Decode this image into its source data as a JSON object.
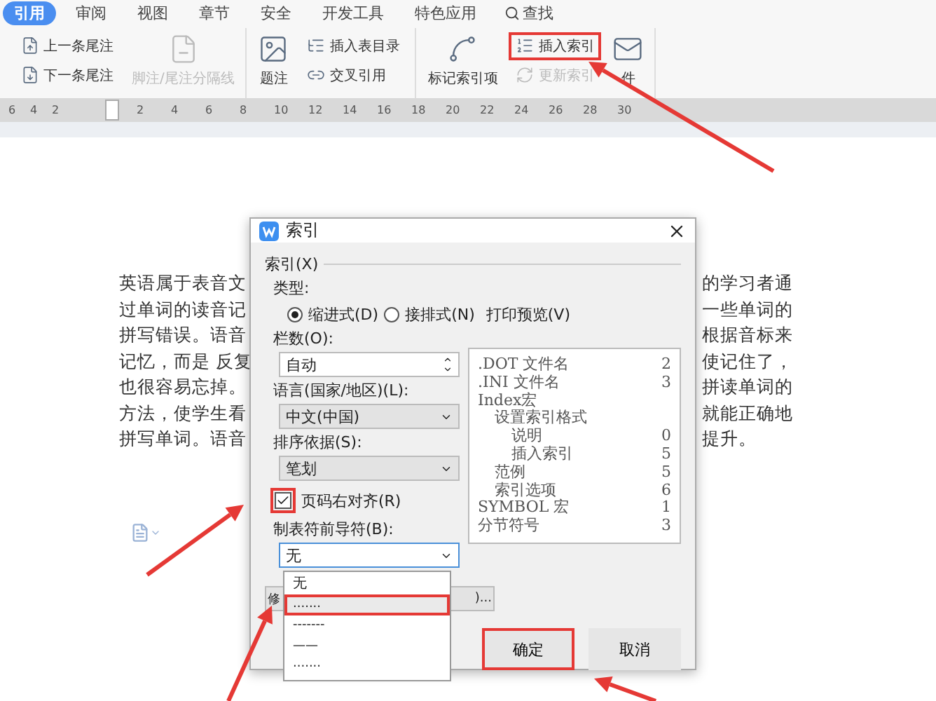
{
  "menu_tabs": [
    {
      "label": "引用",
      "selected": true
    },
    {
      "label": "审阅",
      "selected": false
    },
    {
      "label": "视图",
      "selected": false
    },
    {
      "label": "章节",
      "selected": false
    },
    {
      "label": "安全",
      "selected": false
    },
    {
      "label": "开发工具",
      "selected": false
    },
    {
      "label": "特色应用",
      "selected": false
    }
  ],
  "search": {
    "label": "查找"
  },
  "ribbon": [
    {
      "items": [
        {
          "kind": "stack",
          "buttons": [
            {
              "label": "上一条尾注",
              "disabled": false,
              "highlighted": false
            },
            {
              "label": "下一条尾注",
              "disabled": false,
              "highlighted": false
            }
          ]
        },
        {
          "kind": "large",
          "label": "脚注/尾注分隔线",
          "disabled": true,
          "highlighted": false
        }
      ]
    },
    {
      "items": [
        {
          "kind": "large",
          "label": "题注",
          "disabled": false,
          "highlighted": false
        },
        {
          "kind": "stack",
          "buttons": [
            {
              "label": "插入表目录",
              "disabled": false,
              "highlighted": false
            },
            {
              "label": "交叉引用",
              "disabled": false,
              "highlighted": false
            }
          ]
        }
      ]
    },
    {
      "items": [
        {
          "kind": "large",
          "label": "标记索引项",
          "disabled": false,
          "highlighted": false
        },
        {
          "kind": "stack",
          "buttons": [
            {
              "label": "插入索引",
              "disabled": false,
              "highlighted": true
            },
            {
              "label": "更新索引",
              "disabled": true,
              "highlighted": false
            }
          ]
        },
        {
          "kind": "large",
          "label": "件",
          "disabled": false,
          "highlighted": false
        }
      ]
    }
  ],
  "ruler_marks": [
    "6",
    "4",
    "2",
    "2",
    "4",
    "6",
    "8",
    "10",
    "12",
    "14",
    "16",
    "18",
    "20",
    "22",
    "24",
    "26",
    "28",
    "30"
  ],
  "document": {
    "left_lines": [
      "英语属于表音文",
      "过单词的读音记",
      "拼写错误。语音",
      "记忆，而是 反复",
      "也很容易忘掉。",
      "方法，使学生看",
      "拼写单词。语音"
    ],
    "right_lines": [
      "的学习者通",
      "一些单词的",
      "根据音标来",
      "使记住了，",
      "拼读单词的",
      "就能正确地",
      "提升。"
    ]
  },
  "dialog": {
    "title": "索引",
    "group_label": "索引(X)",
    "type_label": "类型:",
    "type_options": [
      {
        "label": "缩进式(D)",
        "selected": true
      },
      {
        "label": "接排式(N)",
        "selected": false
      }
    ],
    "print_preview": "打印预览(V)",
    "columns": {
      "label": "栏数(O):",
      "value": "自动"
    },
    "language": {
      "label": "语言(国家/地区)(L):",
      "value": "中文(中国)"
    },
    "sort_by": {
      "label": "排序依据(S):",
      "value": "笔划"
    },
    "right_align": {
      "label": "页码右对齐(R)",
      "checked": true,
      "highlighted": true
    },
    "tab_leader": {
      "label": "制表符前导符(B):",
      "value": "无",
      "expanded": true,
      "options": [
        {
          "label": "无",
          "highlighted": false
        },
        {
          "label": ".......",
          "highlighted": true
        },
        {
          "label": "-------",
          "highlighted": false
        },
        {
          "label": "——",
          "highlighted": false
        },
        {
          "label": "·······",
          "highlighted": false
        }
      ]
    },
    "preview": [
      {
        "text": ".DOT 文件名",
        "page": "2"
      },
      {
        "text": ".INI 文件名",
        "page": "3"
      },
      {
        "text": "Index宏",
        "children": [
          {
            "text": "设置索引格式",
            "children": [
              {
                "text": "说明",
                "page": "0"
              },
              {
                "text": "插入索引",
                "page": "5"
              }
            ]
          },
          {
            "text": "范例",
            "page": "5"
          },
          {
            "text": "索引选项",
            "page": "6"
          }
        ]
      },
      {
        "text": "SYMBOL 宏",
        "page": "1"
      },
      {
        "text": "分节符号",
        "page": "3"
      }
    ],
    "hidden_button": {
      "left": "修",
      "right": ")..."
    },
    "buttons": [
      {
        "label": "确定",
        "highlighted": true
      },
      {
        "label": "取消",
        "highlighted": false
      }
    ]
  }
}
